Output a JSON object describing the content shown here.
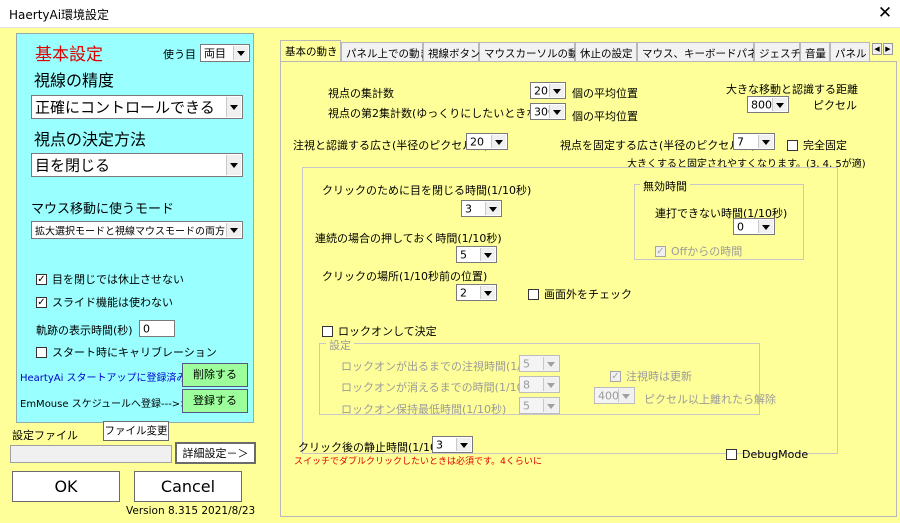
{
  "window": {
    "title": "HaertyAi環境設定",
    "close_glyph": "✕"
  },
  "left": {
    "heading": "基本設定",
    "eye_label": "使う目",
    "eye_value": "両目",
    "gaze_accuracy_label": "視線の精度",
    "gaze_accuracy_value": "正確にコントロールできる",
    "decide_label": "視点の決定方法",
    "decide_value": "目を閉じる",
    "mouse_mode_label": "マウス移動に使うモード",
    "mouse_mode_value": "拡大選択モードと視線マウスモードの両方",
    "chk_no_pause": "目を閉じでは休止させない",
    "chk_no_slide": "スライド機能は使わない",
    "trail_label": "軌跡の表示時間(秒)",
    "trail_value": "0",
    "chk_calibrate": "スタート時にキャリブレーション",
    "startup_status": "HeartyAi スタートアップに登録済み",
    "delete_button": "削除する",
    "schedule_label": "EmMouse スケジュールへ登録--->>>",
    "register_button": "登録する",
    "settings_file_label": "設定ファイル",
    "file_change_button": "ファイル変更",
    "settings_file_value": "",
    "detail_button": "詳細設定－＞",
    "ok_button": "OK",
    "cancel_button": "Cancel",
    "version": "Version 8.315 2021/8/23"
  },
  "tabs": [
    "基本の動き",
    "パネル上での動き",
    "視線ボタン",
    "マウスカーソルの動き",
    "休止の設定",
    "マウス、キーボードパネル",
    "ジェスチャ",
    "音量",
    "パネル"
  ],
  "main": {
    "point_count_label": "視点の集計数",
    "point_count_value": "20",
    "point_count_unit": "個の平均位置",
    "point_count2_label": "視点の第2集計数(ゆっくりにしたいときなど)",
    "point_count2_value": "300",
    "point_count2_unit": "個の平均位置",
    "big_move_label": "大きな移動と認識する距離",
    "big_move_value": "800",
    "big_move_unit": "ピクセル",
    "gaze_area_label": "注視と認識する広さ(半径のピクセル数)",
    "gaze_area_value": "20",
    "fix_area_label": "視点を固定する広さ(半径のピクセル数)",
    "fix_area_value": "7",
    "full_fix_label": "完全固定",
    "fix_hint": "大きくすると固定されやすくなります。(3, 4, 5が適)",
    "close_time_label": "クリックのために目を閉じる時間(1/10秒)",
    "close_time_value": "3",
    "hold_time_label": "連続の場合の押しておく時間(1/10秒)",
    "hold_time_value": "5",
    "click_pos_label": "クリックの場所(1/10秒前の位置)",
    "click_pos_value": "2",
    "offscreen_label": "画面外をチェック",
    "invalid_group_title": "無効時間",
    "no_repeat_label": "連打できない時間(1/10秒)",
    "no_repeat_value": "0",
    "off_time_label": "Offからの時間",
    "lockon_label": "ロックオンして決定",
    "settings_group_title": "設定",
    "lock_appear_label": "ロックオンが出るまでの注視時間(1/10秒)",
    "lock_appear_value": "5",
    "lock_vanish_label": "ロックオンが消えるまでの時間(1/10秒)",
    "lock_vanish_value": "8",
    "lock_min_label": "ロックオン保持最低時間(1/10秒)",
    "lock_min_value": "5",
    "update_on_gaze_label": "注視時は更新",
    "release_px_value": "400",
    "release_px_label": "ピクセル以上離れたら解除",
    "still_time_label": "クリック後の静止時間(1/10秒)",
    "still_time_value": "3",
    "still_time_hint": "スイッチでダブルクリックしたいときは必須です。4くらいに",
    "debug_label": "DebugMode"
  },
  "colors": {
    "left_panel": "#99ffff",
    "background": "#ffff99",
    "green_button": "#9cff9c",
    "accent_red": "#e00000",
    "accent_blue": "#0000cc"
  }
}
